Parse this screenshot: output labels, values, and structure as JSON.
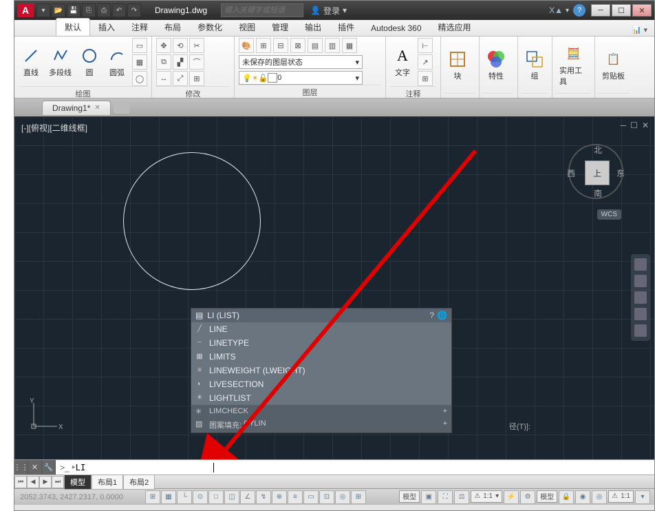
{
  "titlebar": {
    "app_letter": "A",
    "filename": "Drawing1.dwg",
    "search_placeholder": "键入关键字或短语",
    "login_label": "登录",
    "exchange_label": "X"
  },
  "ribbon_tabs": [
    "默认",
    "插入",
    "注释",
    "布局",
    "参数化",
    "视图",
    "管理",
    "输出",
    "插件",
    "Autodesk 360",
    "精选应用"
  ],
  "ribbon_active_tab": 0,
  "panels": {
    "draw": {
      "label": "绘图",
      "tools": {
        "line": "直线",
        "polyline": "多段线",
        "circle": "圆",
        "arc": "圆弧"
      }
    },
    "modify": {
      "label": "修改"
    },
    "layers": {
      "label": "图层",
      "unsaved_state": "未保存的图层状态",
      "current_layer": "0"
    },
    "annotation": {
      "label": "注释",
      "text": "文字"
    },
    "block": {
      "label": "块"
    },
    "properties": {
      "label": "特性"
    },
    "groups": {
      "label": "组"
    },
    "utilities": {
      "label": "实用工具"
    },
    "clipboard": {
      "label": "剪贴板"
    }
  },
  "file_tab": {
    "name": "Drawing1*"
  },
  "drawing": {
    "view_label": "[-][俯视][二维线框]",
    "viewcube": {
      "top": "上",
      "north": "北",
      "south": "南",
      "east": "东",
      "west": "西"
    },
    "wcs": "WCS",
    "status_hint": "径(T)]:"
  },
  "suggestions": {
    "header": "LI (LIST)",
    "items": [
      "LINE",
      "LINETYPE",
      "LIMITS",
      "LINEWEIGHT (LWEIGHT)",
      "LIVESECTION",
      "LIGHTLIST"
    ],
    "footers": [
      {
        "label": "LIMCHECK"
      },
      {
        "label": "图案填充:",
        "extra": "CYLIN"
      }
    ]
  },
  "command": {
    "prompt": ">_",
    "value": "LI"
  },
  "layout_tabs": [
    "模型",
    "布局1",
    "布局2"
  ],
  "status": {
    "coords": "2052.3743, 2427.2317, 0.0000",
    "scale": "1:1",
    "model_btn": "模型",
    "anno": "1:1"
  },
  "ucs_axes": {
    "x": "X",
    "y": "Y"
  }
}
